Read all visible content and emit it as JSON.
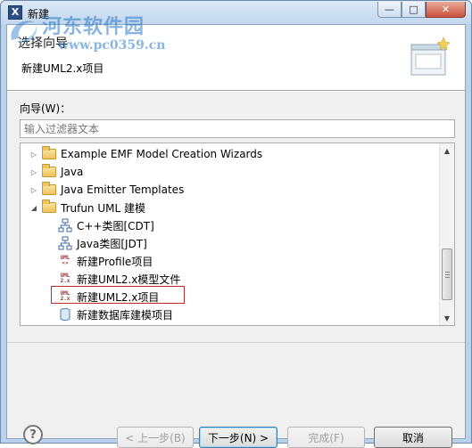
{
  "window": {
    "title": "新建",
    "controls": {
      "minimize": "—",
      "maximize": "□",
      "close": "✕"
    }
  },
  "watermark": {
    "logo_text": "河东软件园",
    "url": "www.pc0359.cn"
  },
  "header": {
    "title": "选择向导",
    "description": "新建UML2.x项目"
  },
  "filter": {
    "label": "向导(W)：",
    "placeholder": "输入过滤器文本"
  },
  "tree": {
    "items": [
      {
        "label": "Example EMF Model Creation Wizards",
        "icon": "folder-icon",
        "expanded": false
      },
      {
        "label": "Java",
        "icon": "folder-icon",
        "expanded": false
      },
      {
        "label": "Java Emitter Templates",
        "icon": "folder-icon",
        "expanded": false
      },
      {
        "label": "Trufun UML 建模",
        "icon": "folder-icon",
        "expanded": true
      },
      {
        "label": "C++类图[CDT]",
        "icon": "class-diagram-icon"
      },
      {
        "label": "Java类图[JDT]",
        "icon": "class-diagram-icon"
      },
      {
        "label": "新建Profile项目",
        "icon": "uml-profile-icon",
        "icon_text": [
          "UML",
          "«»"
        ]
      },
      {
        "label": "新建UML2.x模型文件",
        "icon": "uml2-file-icon",
        "icon_text": [
          "UML",
          "2.x"
        ]
      },
      {
        "label": "新建UML2.x项目",
        "icon": "uml2-project-icon",
        "icon_text": [
          "UML",
          "2.x"
        ],
        "selected": true
      },
      {
        "label": "新建数据库建模项目",
        "icon": "database-icon"
      }
    ]
  },
  "buttons": {
    "back": "< 上一步(B)",
    "next": "下一步(N) >",
    "finish": "完成(F)",
    "cancel": "取消"
  },
  "colors": {
    "selection_border": "#c0292b",
    "title_bar": "#c2d7ee"
  }
}
